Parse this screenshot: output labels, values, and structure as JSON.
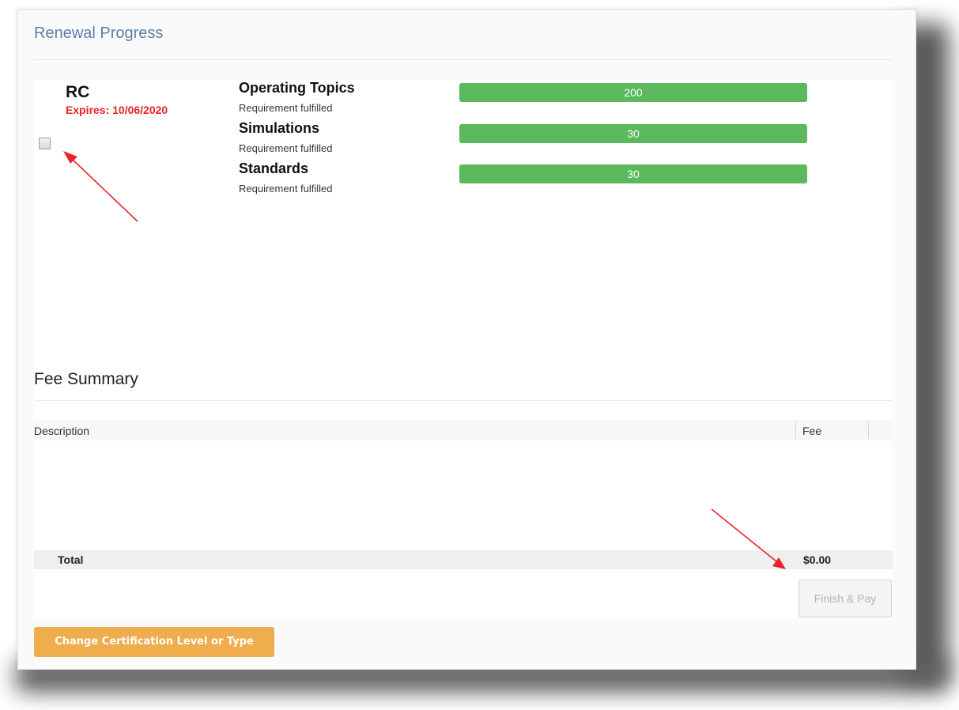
{
  "page": {
    "title": "Renewal Progress"
  },
  "certification": {
    "code": "RC",
    "expires": "Expires: 10/06/2020",
    "selected": false
  },
  "requirements": [
    {
      "name": "Operating Topics",
      "status": "Requirement fulfilled",
      "value": "200",
      "progress_percent": 100
    },
    {
      "name": "Simulations",
      "status": "Requirement fulfilled",
      "value": "30",
      "progress_percent": 100
    },
    {
      "name": "Standards",
      "status": "Requirement fulfilled",
      "value": "30",
      "progress_percent": 100
    }
  ],
  "fees": {
    "title": "Fee Summary",
    "columns": [
      "Description",
      "Fee"
    ],
    "rows": [],
    "total_label": "Total",
    "total_value": "$0.00"
  },
  "buttons": {
    "finish_pay": "Finish & Pay",
    "change_cert": "Change Certification Level or Type"
  },
  "colors": {
    "title": "#5b7fa6",
    "progress": "#5cb85c",
    "expires": "#e8232b",
    "warning_button": "#f0ad4e",
    "annotation_arrow": "#e8232b"
  }
}
